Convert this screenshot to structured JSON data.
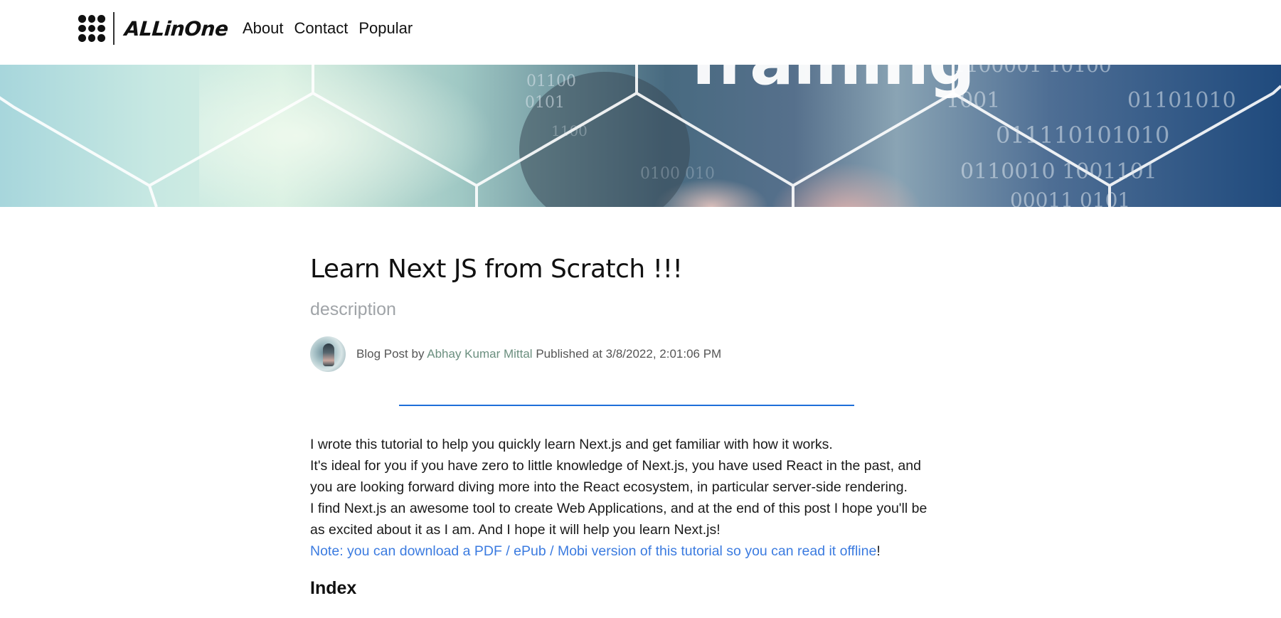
{
  "navbar": {
    "brand_name": "ALLinOne",
    "links": [
      {
        "label": "About"
      },
      {
        "label": "Contact"
      },
      {
        "label": "Popular"
      }
    ]
  },
  "hero": {
    "title_fragment": "Training"
  },
  "post": {
    "title": "Learn Next JS from Scratch !!!",
    "description": "description",
    "byline_prefix": "Blog Post by",
    "author": "Abhay Kumar Mittal",
    "published_label": "Published at",
    "published_at": "3/8/2022, 2:01:06 PM",
    "paragraphs": [
      "I wrote this tutorial to help you quickly learn Next.js and get familiar with how it works.",
      "It's ideal for you if you have zero to little knowledge of Next.js, you have used React in the past, and you are looking forward diving more into the React ecosystem, in particular server-side rendering.",
      "I find Next.js an awesome tool to create Web Applications, and at the end of this post I hope you'll be as excited about it as I am. And I hope it will help you learn Next.js!"
    ],
    "note_link": "Note: you can download a PDF / ePub / Mobi version of this tutorial so you can read it offline",
    "note_suffix": "!",
    "index_heading": "Index"
  },
  "colors": {
    "accent_blue": "#1e6fd9",
    "link_blue": "#3b7be0",
    "author_green": "#6b8f7f",
    "muted_gray": "#a0a4a8"
  }
}
